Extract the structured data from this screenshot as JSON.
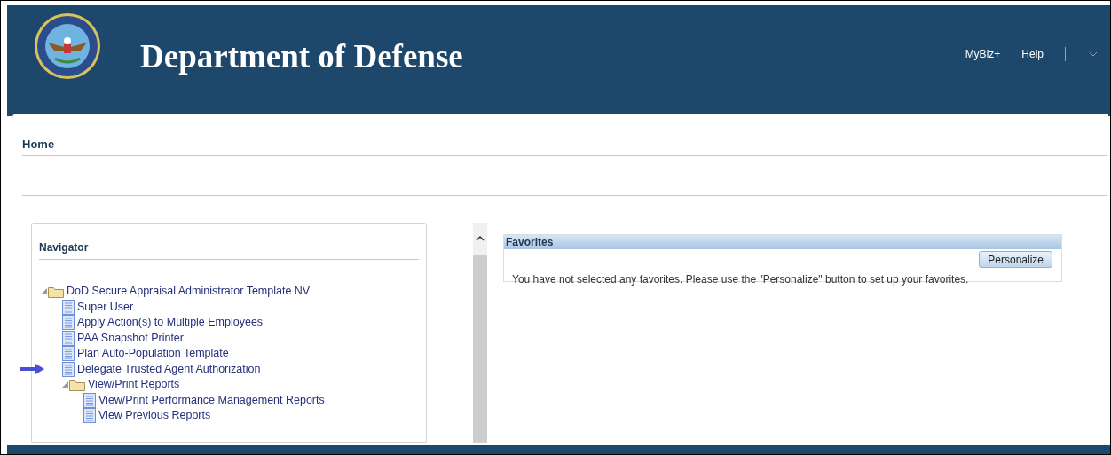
{
  "header": {
    "title": "Department of Defense",
    "links": [
      "MyBiz+",
      "Help"
    ]
  },
  "page": {
    "title": "Home"
  },
  "navigator": {
    "title": "Navigator",
    "tree": [
      {
        "label": "DoD Secure Appraisal Administrator Template NV",
        "kind": "folder",
        "expanded": true,
        "marked": false,
        "children": [
          {
            "label": "Super User",
            "kind": "page",
            "marked": false
          },
          {
            "label": "Apply Action(s) to Multiple Employees",
            "kind": "page",
            "marked": false
          },
          {
            "label": "PAA Snapshot Printer",
            "kind": "page",
            "marked": false
          },
          {
            "label": "Plan Auto-Population Template",
            "kind": "page",
            "marked": false
          },
          {
            "label": "Delegate Trusted Agent Authorization",
            "kind": "page",
            "marked": true
          },
          {
            "label": "View/Print Reports",
            "kind": "folder",
            "expanded": true,
            "marked": false,
            "children": [
              {
                "label": "View/Print Performance Management Reports",
                "kind": "page",
                "marked": false
              },
              {
                "label": "View Previous Reports",
                "kind": "page",
                "marked": false
              }
            ]
          }
        ]
      }
    ]
  },
  "favorites": {
    "title": "Favorites",
    "button": "Personalize",
    "message": "You have not selected any favorites. Please use the \"Personalize\" button to set up your favorites."
  }
}
